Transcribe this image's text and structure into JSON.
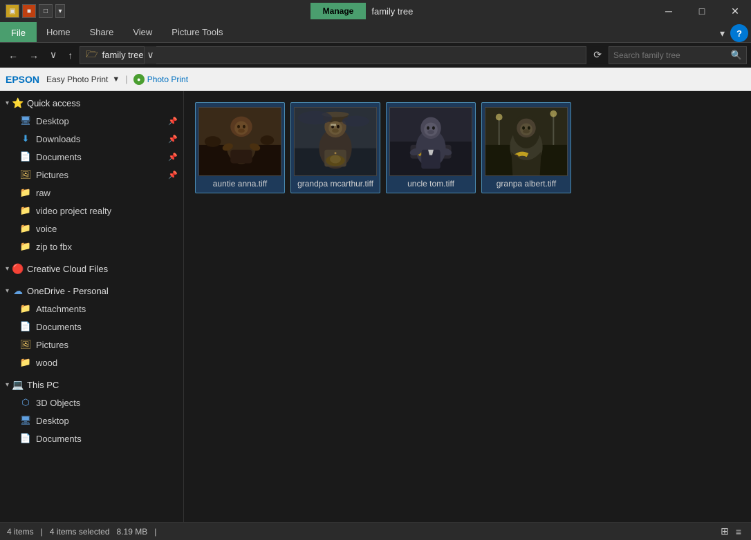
{
  "titleBar": {
    "manage_label": "Manage",
    "title": "family tree",
    "minimize": "─",
    "maximize": "□",
    "close": "✕"
  },
  "ribbonTabs": {
    "file": "File",
    "home": "Home",
    "share": "Share",
    "view": "View",
    "pictureTools": "Picture Tools"
  },
  "addressBar": {
    "back": "←",
    "forward": "→",
    "dropdown": "∨",
    "up": "↑",
    "folderIcon": "🗁",
    "path": "family tree",
    "refresh": "⟳",
    "searchPlaceholder": "Search family tree",
    "searchIcon": "🔍"
  },
  "epson": {
    "logo": "EPSON",
    "text": "Easy Photo Print",
    "dropdown": "▼",
    "divider": "|",
    "photoLabel": "Photo Print",
    "greenIcon": "●"
  },
  "sidebar": {
    "quickAccess": {
      "label": "Quick access",
      "icon": "⭐",
      "arrow": "▾"
    },
    "items": [
      {
        "label": "Desktop",
        "icon": "🖥",
        "pinned": true
      },
      {
        "label": "Downloads",
        "icon": "⬇",
        "pinned": true,
        "iconClass": "icon-downloads"
      },
      {
        "label": "Documents",
        "icon": "📄",
        "pinned": true
      },
      {
        "label": "Pictures",
        "icon": "🖼",
        "pinned": true
      },
      {
        "label": "raw",
        "icon": "📁"
      },
      {
        "label": "video project realty",
        "icon": "📁"
      },
      {
        "label": "voice",
        "icon": "📁"
      },
      {
        "label": "zip to fbx",
        "icon": "📁"
      }
    ],
    "creativeCloud": {
      "label": "Creative Cloud Files",
      "icon": "🔴",
      "arrow": "▾"
    },
    "oneDrive": {
      "label": "OneDrive - Personal",
      "icon": "☁",
      "arrow": "▾"
    },
    "oneDriveItems": [
      {
        "label": "Attachments",
        "icon": "📁"
      },
      {
        "label": "Documents",
        "icon": "📄"
      },
      {
        "label": "Pictures",
        "icon": "🖼"
      },
      {
        "label": "wood",
        "icon": "📁"
      }
    ],
    "thisPC": {
      "label": "This PC",
      "icon": "💻",
      "arrow": "▾"
    },
    "thisPCItems": [
      {
        "label": "3D Objects",
        "icon": "🖧"
      },
      {
        "label": "Desktop",
        "icon": "🖥"
      },
      {
        "label": "Documents",
        "icon": "📄"
      }
    ]
  },
  "files": [
    {
      "name": "auntie anna.tiff",
      "selected": true,
      "bg": "#3a2a1a",
      "color1": "#6a4a2a",
      "color2": "#8a6a3a"
    },
    {
      "name": "grandpa mcarthur.tiff",
      "selected": true,
      "bg": "#2a3a3a",
      "color1": "#5a6a5a",
      "color2": "#7a8a6a"
    },
    {
      "name": "uncle tom.tiff",
      "selected": true,
      "bg": "#2a2a3a",
      "color1": "#4a4a6a",
      "color2": "#6a6a8a"
    },
    {
      "name": "granpa albert.tiff",
      "selected": true,
      "bg": "#3a3a2a",
      "color1": "#6a6a4a",
      "color2": "#8a8a5a"
    }
  ],
  "statusBar": {
    "itemCount": "4 items",
    "divider1": "|",
    "selected": "4 items selected",
    "size": "8.19 MB",
    "divider2": "|"
  }
}
